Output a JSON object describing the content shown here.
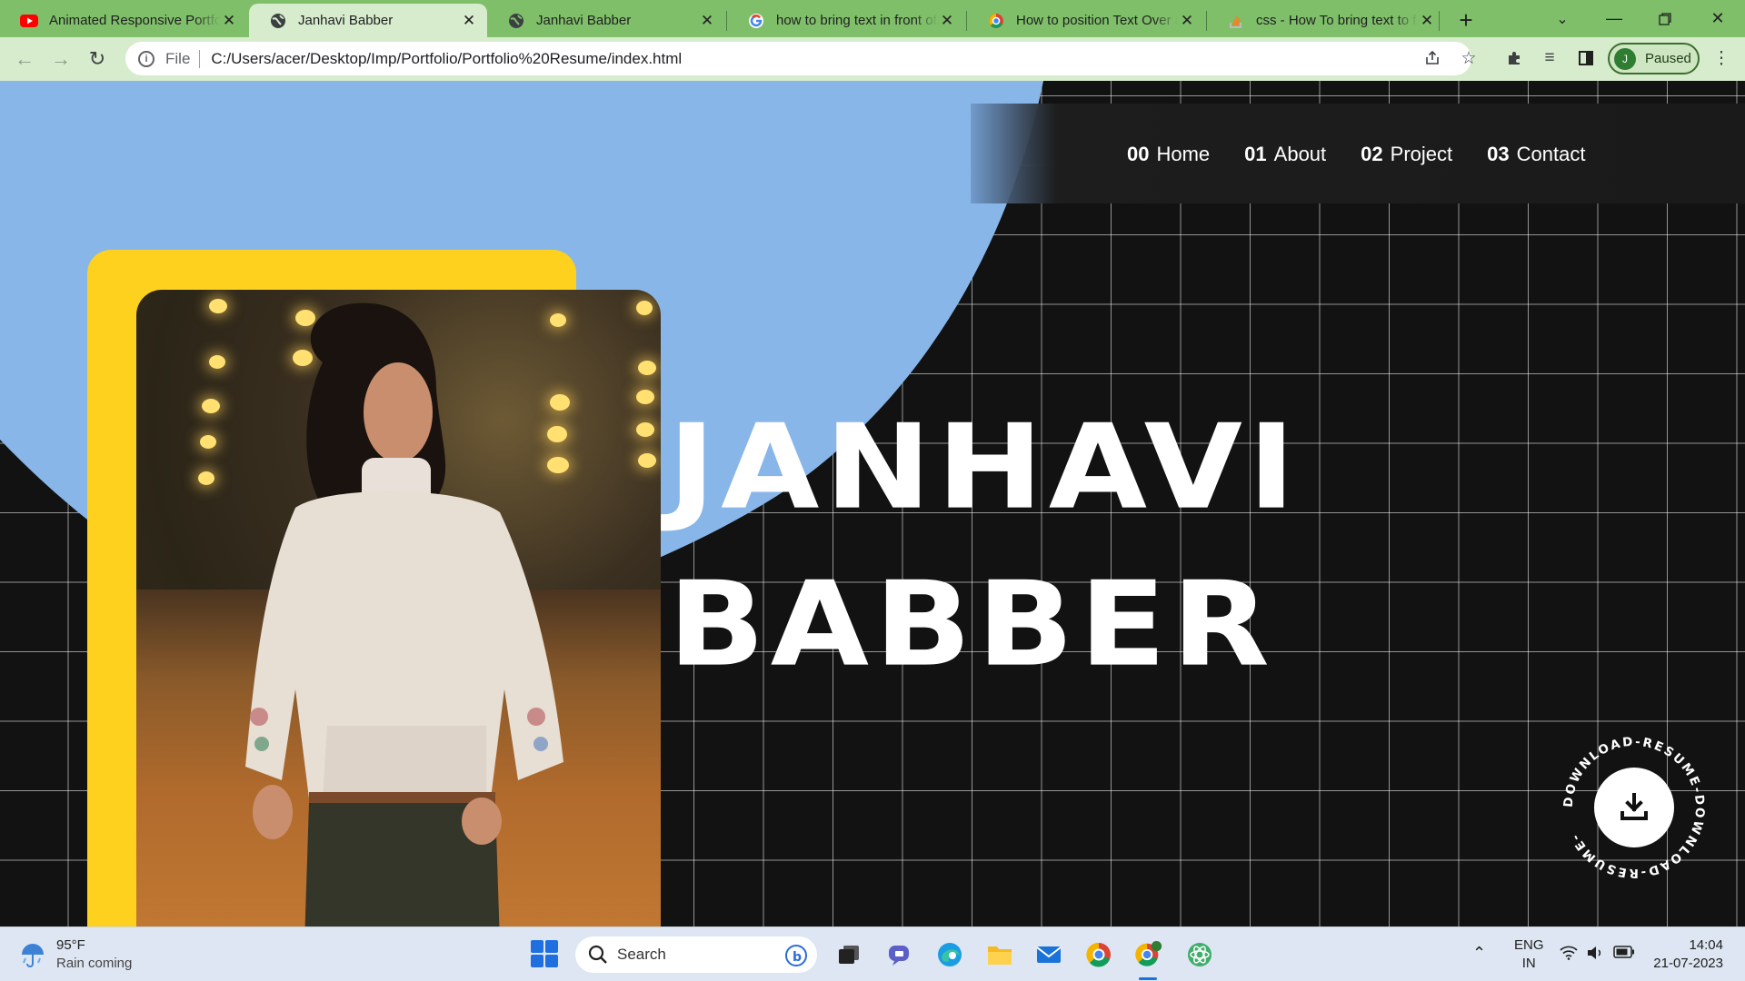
{
  "browser": {
    "tabs": [
      {
        "title": "Animated Responsive Portfolio",
        "favicon": "youtube-icon",
        "active": false
      },
      {
        "title": "Janhavi Babber",
        "favicon": "globe-icon",
        "active": true
      },
      {
        "title": "Janhavi Babber",
        "favicon": "globe-icon",
        "active": false
      },
      {
        "title": "how to bring text in front of",
        "favicon": "google-icon",
        "active": false
      },
      {
        "title": "How to position Text Over an",
        "favicon": "chrome-icon",
        "active": false
      },
      {
        "title": "css - How To bring text to fro",
        "favicon": "stackoverflow-icon",
        "active": false
      }
    ],
    "address": {
      "scheme_label": "File",
      "url": "C:/Users/acer/Desktop/Imp/Portfolio/Portfolio%20Resume/index.html"
    },
    "profile": {
      "initial": "J",
      "status": "Paused"
    }
  },
  "page": {
    "nav": [
      {
        "num": "00",
        "label": "Home"
      },
      {
        "num": "01",
        "label": "About"
      },
      {
        "num": "02",
        "label": "Project"
      },
      {
        "num": "03",
        "label": "Contact"
      }
    ],
    "name_line1": "JANHAVI",
    "name_line2": "BABBER",
    "download_ring_text": "DOWNLOAD-RESUME-DOWNLOAD-RESUME-",
    "colors": {
      "accent_blue": "#89b6e8",
      "accent_yellow": "#fdd11e",
      "background": "#121212"
    }
  },
  "taskbar": {
    "weather": {
      "temp": "95°F",
      "status": "Rain coming"
    },
    "search_label": "Search",
    "language": {
      "line1": "ENG",
      "line2": "IN"
    },
    "clock": {
      "time": "14:04",
      "date": "21-07-2023"
    }
  }
}
